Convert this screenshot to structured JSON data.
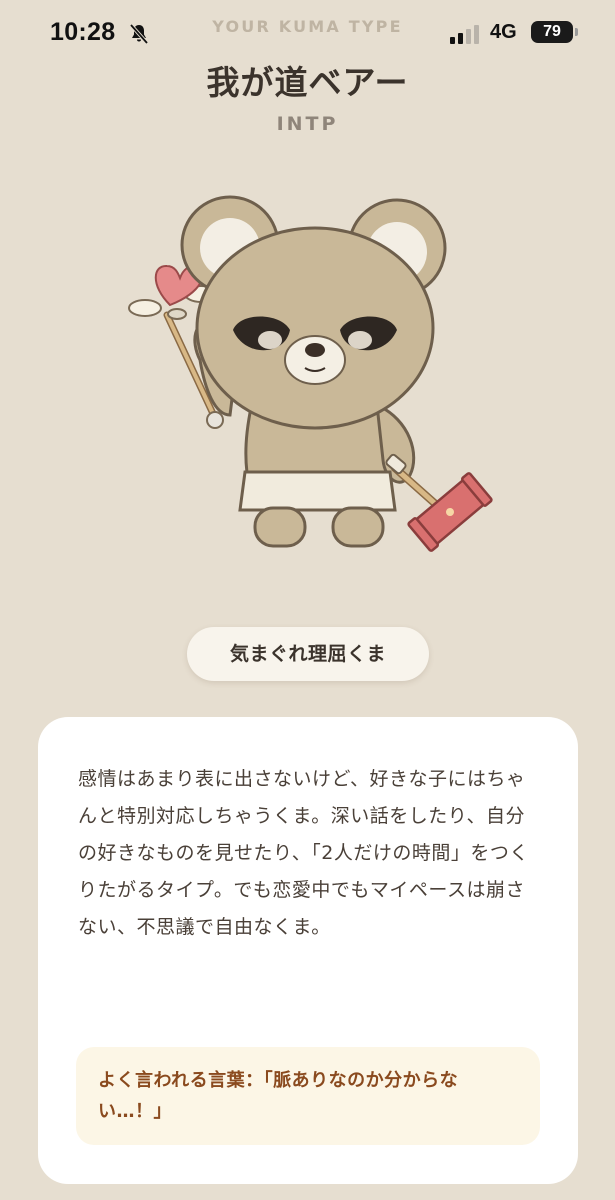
{
  "status_bar": {
    "time": "10:28",
    "network": "4G",
    "battery": "79"
  },
  "result": {
    "eyebrow": "YOUR KUMA TYPE",
    "type_name": "我が道ベアー",
    "mbti": "INTP",
    "nickname": "気まぐれ理屈くま",
    "description": "感情はあまり表に出さないけど、好きな子にはちゃんと特別対応しちゃうくま。深い話をしたり、自分の好きなものを見せたり、「2人だけの時間」をつくりたがるタイプ。でも恋愛中でもマイペースは崩さない、不思議で自由なくま。",
    "quote": "よく言われる言葉：「脈ありなのか分からない…！」"
  },
  "colors": {
    "background": "#e6ded0",
    "card": "#ffffff",
    "quote_bg": "#fcf6e6",
    "quote_text": "#8a4a1e",
    "bear_fur": "#c9b898",
    "bear_fur_dark": "#7a6a55",
    "heart": "#e58a8a",
    "hammer": "#d9706f"
  },
  "icons": {
    "silent": "bell-slash-icon",
    "signal": "signal-bars-icon"
  }
}
